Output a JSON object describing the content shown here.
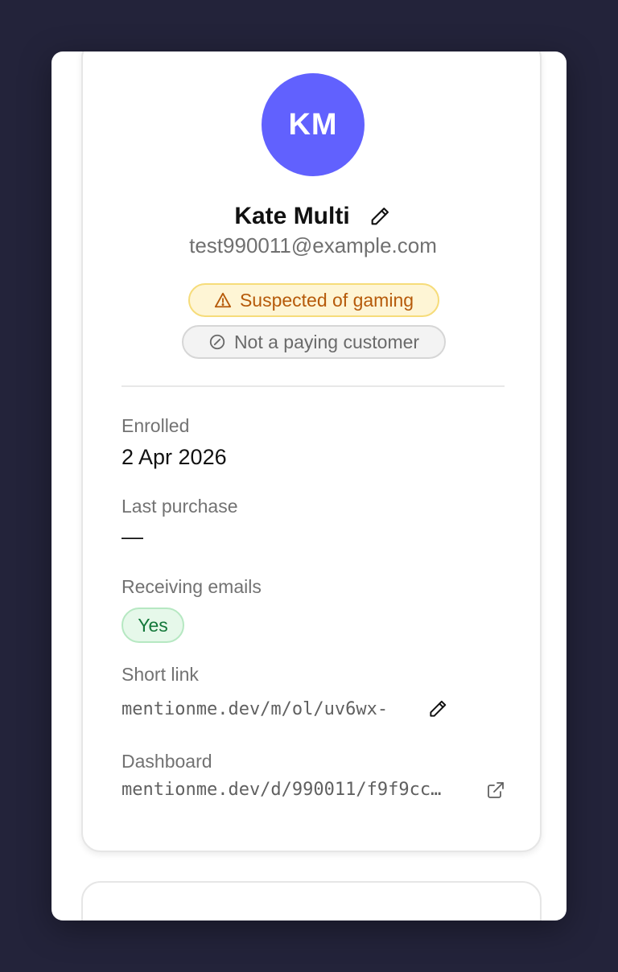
{
  "profile": {
    "initials": "KM",
    "avatar_color": "#6161fe",
    "name": "Kate Multi",
    "email": "test990011@example.com"
  },
  "badges": {
    "gaming": {
      "label": "Suspected of gaming",
      "icon": "warning-triangle-icon"
    },
    "paying": {
      "label": "Not a paying customer",
      "icon": "prohibited-icon"
    }
  },
  "details": {
    "enrolled_label": "Enrolled",
    "enrolled_value": "2 Apr 2026",
    "last_purchase_label": "Last purchase",
    "last_purchase_value": "—",
    "receiving_emails_label": "Receiving emails",
    "receiving_emails_value": "Yes",
    "short_link_label": "Short link",
    "short_link_value": "mentionme.dev/m/ol/uv6wx-",
    "dashboard_label": "Dashboard",
    "dashboard_value": "mentionme.dev/d/990011/f9f9cc…"
  },
  "icons": {
    "name_edit": "pencil-icon",
    "short_link_edit": "pencil-icon",
    "dashboard_open": "external-link-icon"
  }
}
